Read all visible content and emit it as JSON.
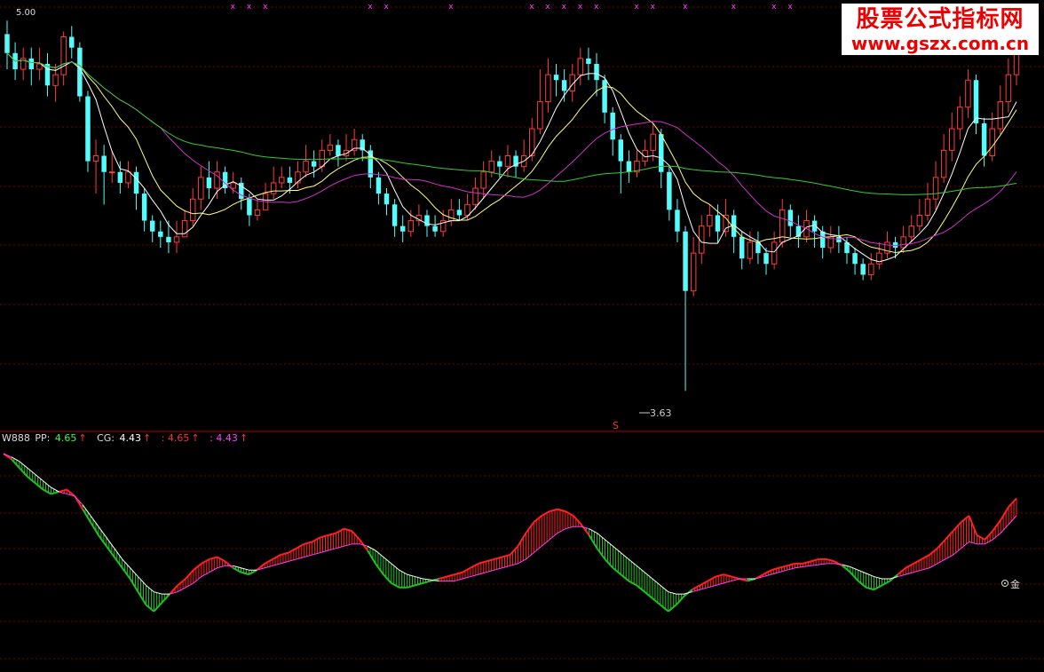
{
  "colors": {
    "bg": "#000000",
    "up": "#ff3b3b",
    "down": "#54fcfc",
    "ma5": "#ffffff",
    "ma10": "#ffff80",
    "ma20": "#cc33cc",
    "ma60": "#33cc33",
    "grid": "#7a0000",
    "macd_up": "#ff2020",
    "macd_down": "#20c020",
    "macd_line_white": "#ffffff",
    "macd_line_magenta": "#ff40ff",
    "marker": "#ff40ff"
  },
  "watermark": {
    "title": "股票公式指标网",
    "url": "www.gszx.com.cn"
  },
  "top_label": "5.00",
  "low_label": "3.63",
  "s_marker": "S",
  "indicator_header": {
    "name": "W888",
    "pp_label": "PP:",
    "pp_value": "4.65",
    "cg_label": "CG:",
    "cg_value": "4.43",
    "v3": ": 4.65",
    "v4": ": 4.43",
    "arrow": "↑"
  },
  "gold_label": "金",
  "chart_data": [
    {
      "type": "candlestick",
      "price_range": [
        3.5,
        5.05
      ],
      "low_annotation": 3.63,
      "top_markers": [
        "x",
        "x",
        "x",
        "x",
        "x",
        "x",
        "x",
        "x",
        "x",
        "x",
        "x",
        "x",
        "x",
        "x",
        "x",
        "x",
        "x",
        "x",
        "x",
        "x"
      ],
      "candles": [
        [
          4.95,
          4.88,
          5.0,
          4.82
        ],
        [
          4.88,
          4.82,
          4.92,
          4.78
        ],
        [
          4.82,
          4.86,
          4.9,
          4.78
        ],
        [
          4.86,
          4.82,
          4.9,
          4.76
        ],
        [
          4.82,
          4.84,
          4.9,
          4.78
        ],
        [
          4.84,
          4.76,
          4.88,
          4.72
        ],
        [
          4.76,
          4.8,
          4.84,
          4.7
        ],
        [
          4.8,
          4.94,
          4.96,
          4.76
        ],
        [
          4.94,
          4.9,
          4.98,
          4.86
        ],
        [
          4.9,
          4.72,
          4.92,
          4.7
        ],
        [
          4.72,
          4.48,
          4.74,
          4.44
        ],
        [
          4.48,
          4.5,
          4.56,
          4.36
        ],
        [
          4.5,
          4.44,
          4.54,
          4.32
        ],
        [
          4.44,
          4.44,
          4.52,
          4.4
        ],
        [
          4.44,
          4.4,
          4.48,
          4.36
        ],
        [
          4.4,
          4.44,
          4.48,
          4.38
        ],
        [
          4.44,
          4.36,
          4.46,
          4.3
        ],
        [
          4.36,
          4.26,
          4.38,
          4.22
        ],
        [
          4.26,
          4.22,
          4.28,
          4.18
        ],
        [
          4.22,
          4.2,
          4.26,
          4.16
        ],
        [
          4.2,
          4.18,
          4.26,
          4.14
        ],
        [
          4.18,
          4.2,
          4.26,
          4.14
        ],
        [
          4.2,
          4.26,
          4.3,
          4.2
        ],
        [
          4.26,
          4.34,
          4.38,
          4.24
        ],
        [
          4.34,
          4.42,
          4.46,
          4.3
        ],
        [
          4.42,
          4.38,
          4.48,
          4.34
        ],
        [
          4.38,
          4.44,
          4.48,
          4.34
        ],
        [
          4.44,
          4.38,
          4.46,
          4.36
        ],
        [
          4.38,
          4.4,
          4.44,
          4.36
        ],
        [
          4.4,
          4.34,
          4.42,
          4.3
        ],
        [
          4.34,
          4.28,
          4.36,
          4.24
        ],
        [
          4.28,
          4.3,
          4.34,
          4.26
        ],
        [
          4.3,
          4.36,
          4.4,
          4.3
        ],
        [
          4.36,
          4.4,
          4.46,
          4.34
        ],
        [
          4.4,
          4.42,
          4.46,
          4.38
        ],
        [
          4.42,
          4.4,
          4.46,
          4.36
        ],
        [
          4.4,
          4.44,
          4.48,
          4.38
        ],
        [
          4.44,
          4.48,
          4.54,
          4.42
        ],
        [
          4.48,
          4.46,
          4.52,
          4.42
        ],
        [
          4.46,
          4.52,
          4.56,
          4.44
        ],
        [
          4.52,
          4.54,
          4.58,
          4.5
        ],
        [
          4.54,
          4.5,
          4.56,
          4.46
        ],
        [
          4.5,
          4.52,
          4.58,
          4.48
        ],
        [
          4.52,
          4.56,
          4.6,
          4.5
        ],
        [
          4.56,
          4.52,
          4.58,
          4.48
        ],
        [
          4.52,
          4.42,
          4.54,
          4.38
        ],
        [
          4.42,
          4.36,
          4.44,
          4.32
        ],
        [
          4.36,
          4.32,
          4.38,
          4.28
        ],
        [
          4.32,
          4.24,
          4.34,
          4.2
        ],
        [
          4.24,
          4.22,
          4.28,
          4.18
        ],
        [
          4.22,
          4.26,
          4.3,
          4.2
        ],
        [
          4.26,
          4.28,
          4.32,
          4.24
        ],
        [
          4.28,
          4.24,
          4.3,
          4.2
        ],
        [
          4.24,
          4.22,
          4.28,
          4.2
        ],
        [
          4.22,
          4.26,
          4.3,
          4.2
        ],
        [
          4.26,
          4.3,
          4.34,
          4.24
        ],
        [
          4.3,
          4.28,
          4.34,
          4.26
        ],
        [
          4.28,
          4.32,
          4.36,
          4.26
        ],
        [
          4.32,
          4.38,
          4.42,
          4.3
        ],
        [
          4.38,
          4.44,
          4.48,
          4.34
        ],
        [
          4.44,
          4.48,
          4.52,
          4.42
        ],
        [
          4.48,
          4.46,
          4.5,
          4.42
        ],
        [
          4.46,
          4.5,
          4.54,
          4.42
        ],
        [
          4.5,
          4.46,
          4.52,
          4.42
        ],
        [
          4.46,
          4.5,
          4.56,
          4.44
        ],
        [
          4.5,
          4.6,
          4.64,
          4.48
        ],
        [
          4.6,
          4.7,
          4.82,
          4.58
        ],
        [
          4.7,
          4.8,
          4.86,
          4.66
        ],
        [
          4.8,
          4.78,
          4.84,
          4.72
        ],
        [
          4.78,
          4.74,
          4.82,
          4.7
        ],
        [
          4.74,
          4.8,
          4.84,
          4.7
        ],
        [
          4.8,
          4.86,
          4.9,
          4.76
        ],
        [
          4.86,
          4.84,
          4.9,
          4.78
        ],
        [
          4.84,
          4.78,
          4.88,
          4.72
        ],
        [
          4.78,
          4.66,
          4.8,
          4.62
        ],
        [
          4.66,
          4.56,
          4.68,
          4.5
        ],
        [
          4.56,
          4.48,
          4.58,
          4.36
        ],
        [
          4.48,
          4.44,
          4.52,
          4.4
        ],
        [
          4.44,
          4.48,
          4.52,
          4.42
        ],
        [
          4.48,
          4.52,
          4.56,
          4.46
        ],
        [
          4.52,
          4.58,
          4.62,
          4.48
        ],
        [
          4.58,
          4.44,
          4.6,
          4.38
        ],
        [
          4.44,
          4.3,
          4.46,
          4.26
        ],
        [
          4.3,
          4.22,
          4.34,
          4.18
        ],
        [
          4.22,
          4.0,
          4.24,
          3.63
        ],
        [
          4.0,
          4.14,
          4.2,
          3.98
        ],
        [
          4.14,
          4.24,
          4.28,
          4.1
        ],
        [
          4.24,
          4.28,
          4.32,
          4.2
        ],
        [
          4.28,
          4.22,
          4.32,
          4.18
        ],
        [
          4.22,
          4.28,
          4.34,
          4.2
        ],
        [
          4.28,
          4.2,
          4.3,
          4.14
        ],
        [
          4.2,
          4.12,
          4.22,
          4.08
        ],
        [
          4.12,
          4.18,
          4.22,
          4.1
        ],
        [
          4.18,
          4.14,
          4.22,
          4.1
        ],
        [
          4.14,
          4.1,
          4.16,
          4.06
        ],
        [
          4.1,
          4.18,
          4.22,
          4.08
        ],
        [
          4.18,
          4.3,
          4.34,
          4.16
        ],
        [
          4.3,
          4.24,
          4.32,
          4.2
        ],
        [
          4.24,
          4.2,
          4.28,
          4.16
        ],
        [
          4.2,
          4.26,
          4.3,
          4.18
        ],
        [
          4.26,
          4.22,
          4.28,
          4.16
        ],
        [
          4.22,
          4.16,
          4.24,
          4.12
        ],
        [
          4.16,
          4.2,
          4.24,
          4.14
        ],
        [
          4.2,
          4.18,
          4.24,
          4.14
        ],
        [
          4.18,
          4.14,
          4.2,
          4.1
        ],
        [
          4.14,
          4.1,
          4.16,
          4.06
        ],
        [
          4.1,
          4.06,
          4.12,
          4.04
        ],
        [
          4.06,
          4.1,
          4.14,
          4.04
        ],
        [
          4.1,
          4.14,
          4.18,
          4.08
        ],
        [
          4.14,
          4.18,
          4.22,
          4.12
        ],
        [
          4.18,
          4.16,
          4.2,
          4.12
        ],
        [
          4.16,
          4.2,
          4.24,
          4.14
        ],
        [
          4.2,
          4.24,
          4.28,
          4.18
        ],
        [
          4.24,
          4.28,
          4.34,
          4.22
        ],
        [
          4.28,
          4.34,
          4.4,
          4.26
        ],
        [
          4.34,
          4.42,
          4.48,
          4.3
        ],
        [
          4.42,
          4.52,
          4.58,
          4.4
        ],
        [
          4.52,
          4.6,
          4.66,
          4.48
        ],
        [
          4.6,
          4.68,
          4.72,
          4.56
        ],
        [
          4.68,
          4.78,
          4.82,
          4.64
        ],
        [
          4.78,
          4.62,
          4.8,
          4.58
        ],
        [
          4.62,
          4.5,
          4.64,
          4.46
        ],
        [
          4.5,
          4.6,
          4.66,
          4.48
        ],
        [
          4.6,
          4.7,
          4.76,
          4.58
        ],
        [
          4.7,
          4.8,
          4.86,
          4.66
        ],
        [
          4.8,
          4.9,
          4.96,
          4.76
        ]
      ],
      "ma_series": [
        {
          "name": "MA5",
          "color": "#ffffff"
        },
        {
          "name": "MA10",
          "color": "#ffff80"
        },
        {
          "name": "MA20",
          "color": "#cc33cc"
        },
        {
          "name": "MA60",
          "color": "#33cc33"
        }
      ]
    },
    {
      "type": "area",
      "range": [
        -1.0,
        1.0
      ],
      "pp": [
        0.95,
        0.9,
        0.82,
        0.74,
        0.68,
        0.62,
        0.58,
        0.6,
        0.62,
        0.56,
        0.44,
        0.32,
        0.2,
        0.1,
        0.0,
        -0.1,
        -0.2,
        -0.32,
        -0.44,
        -0.5,
        -0.42,
        -0.34,
        -0.26,
        -0.2,
        -0.12,
        -0.06,
        -0.02,
        0.0,
        -0.04,
        -0.1,
        -0.14,
        -0.16,
        -0.12,
        -0.06,
        -0.02,
        0.02,
        0.04,
        0.08,
        0.12,
        0.14,
        0.18,
        0.2,
        0.22,
        0.26,
        0.24,
        0.16,
        0.06,
        -0.06,
        -0.16,
        -0.24,
        -0.28,
        -0.28,
        -0.26,
        -0.24,
        -0.22,
        -0.2,
        -0.18,
        -0.16,
        -0.14,
        -0.1,
        -0.06,
        -0.04,
        -0.02,
        0.0,
        0.02,
        0.1,
        0.22,
        0.32,
        0.38,
        0.42,
        0.44,
        0.42,
        0.38,
        0.3,
        0.2,
        0.08,
        -0.02,
        -0.1,
        -0.16,
        -0.22,
        -0.26,
        -0.32,
        -0.38,
        -0.44,
        -0.5,
        -0.44,
        -0.36,
        -0.3,
        -0.26,
        -0.22,
        -0.18,
        -0.16,
        -0.18,
        -0.2,
        -0.22,
        -0.2,
        -0.16,
        -0.12,
        -0.1,
        -0.08,
        -0.06,
        -0.06,
        -0.04,
        -0.02,
        -0.02,
        -0.04,
        -0.08,
        -0.14,
        -0.22,
        -0.28,
        -0.3,
        -0.26,
        -0.22,
        -0.16,
        -0.1,
        -0.06,
        -0.02,
        0.02,
        0.08,
        0.16,
        0.24,
        0.32,
        0.38,
        0.2,
        0.16,
        0.24,
        0.34,
        0.46,
        0.54
      ],
      "cg": [
        0.95,
        0.92,
        0.88,
        0.82,
        0.76,
        0.7,
        0.64,
        0.6,
        0.58,
        0.56,
        0.48,
        0.38,
        0.28,
        0.18,
        0.08,
        -0.02,
        -0.1,
        -0.18,
        -0.26,
        -0.32,
        -0.34,
        -0.34,
        -0.32,
        -0.28,
        -0.24,
        -0.18,
        -0.14,
        -0.1,
        -0.08,
        -0.08,
        -0.1,
        -0.12,
        -0.12,
        -0.1,
        -0.08,
        -0.06,
        -0.04,
        -0.02,
        0.0,
        0.02,
        0.04,
        0.06,
        0.08,
        0.1,
        0.12,
        0.12,
        0.1,
        0.06,
        0.0,
        -0.06,
        -0.12,
        -0.16,
        -0.18,
        -0.2,
        -0.21,
        -0.22,
        -0.22,
        -0.22,
        -0.2,
        -0.18,
        -0.16,
        -0.14,
        -0.12,
        -0.1,
        -0.08,
        -0.06,
        -0.02,
        0.04,
        0.1,
        0.16,
        0.22,
        0.26,
        0.28,
        0.28,
        0.26,
        0.22,
        0.16,
        0.1,
        0.04,
        -0.02,
        -0.08,
        -0.14,
        -0.2,
        -0.26,
        -0.32,
        -0.34,
        -0.34,
        -0.32,
        -0.3,
        -0.28,
        -0.26,
        -0.24,
        -0.22,
        -0.2,
        -0.2,
        -0.2,
        -0.18,
        -0.16,
        -0.14,
        -0.12,
        -0.1,
        -0.09,
        -0.08,
        -0.07,
        -0.06,
        -0.06,
        -0.07,
        -0.09,
        -0.12,
        -0.15,
        -0.18,
        -0.2,
        -0.2,
        -0.18,
        -0.16,
        -0.14,
        -0.12,
        -0.1,
        -0.06,
        -0.02,
        0.02,
        0.08,
        0.14,
        0.12,
        0.12,
        0.16,
        0.22,
        0.3,
        0.38
      ]
    }
  ]
}
